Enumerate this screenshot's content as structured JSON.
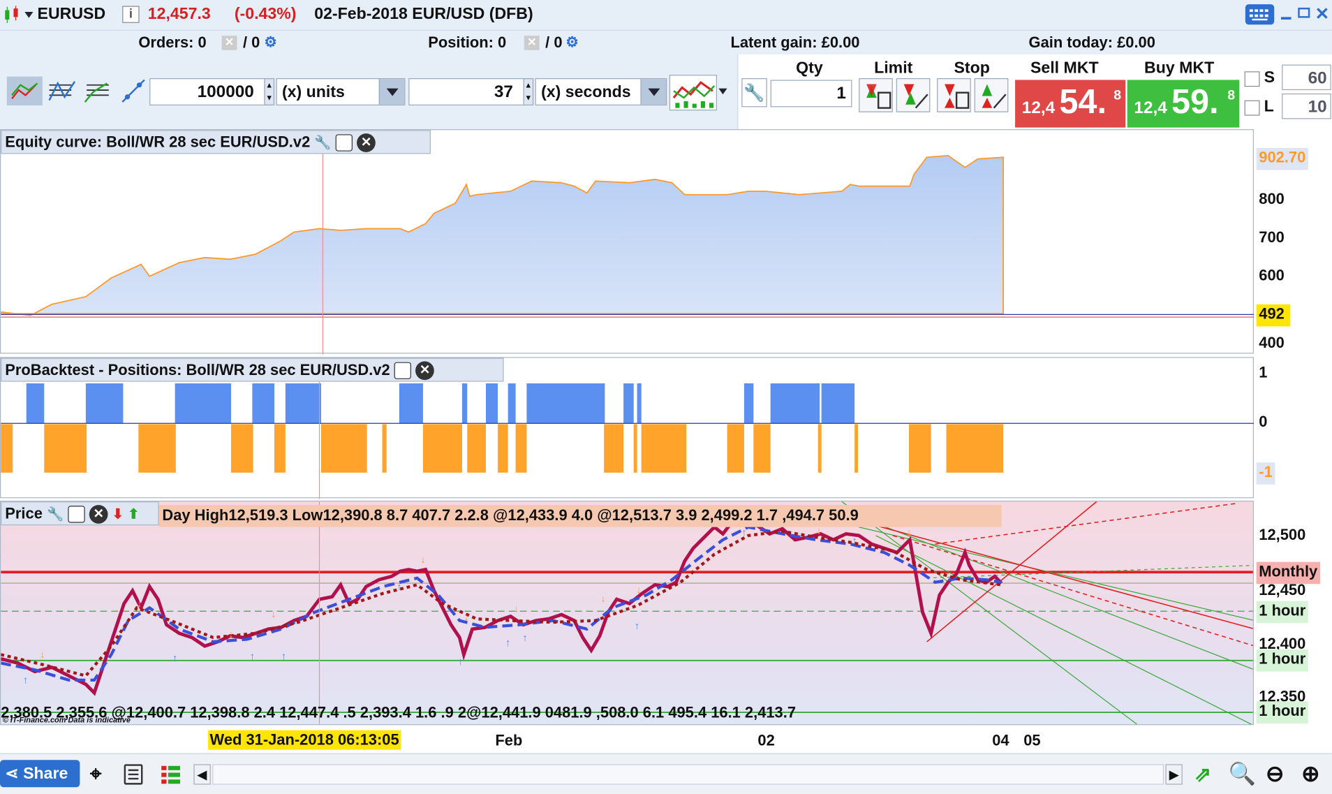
{
  "header": {
    "symbol": "EURUSD",
    "price": "12,457.3",
    "change": "(-0.43%)",
    "contract": "02-Feb-2018 EUR/USD (DFB)",
    "info_icon": "i"
  },
  "status": {
    "orders_label": "Orders: 0",
    "orders_sep": "/ 0",
    "position_label": "Position: 0",
    "position_sep": "/ 0",
    "latent_gain": "Latent gain: £0.00",
    "gain_today": "Gain today: £0.00"
  },
  "toolbar": {
    "units_value": "100000",
    "units_mode": "(x) units",
    "period_value": "37",
    "period_mode": "(x) seconds"
  },
  "order": {
    "qty_label": "Qty",
    "qty_value": "1",
    "limit_label": "Limit",
    "stop_label": "Stop",
    "sell_label": "Sell MKT",
    "buy_label": "Buy MKT",
    "sell_prefix": "12,4",
    "sell_big": "54.",
    "sell_sup": "8",
    "buy_prefix": "12,4",
    "buy_big": "59.",
    "buy_sup": "8",
    "s_label": "S",
    "s_value": "60",
    "l_label": "L",
    "l_value": "10"
  },
  "equity": {
    "title": "Equity curve: Boll/WR 28 sec EUR/USD.v2",
    "axis": [
      "800",
      "700",
      "600",
      "400"
    ],
    "last_value": "902.70",
    "start_value": "492"
  },
  "positions": {
    "title": "ProBacktest - Positions: Boll/WR 28 sec EUR/USD.v2",
    "axis": [
      "1",
      "0",
      "-1"
    ]
  },
  "price": {
    "title": "Price",
    "overlay_text": "Day High12,519.3 Low12,390.8 8.7 407.7 2.2.8 @12,433.9 4.0 @12,513.7 3.9 2,499.2 1.7 ,494.7 50.9",
    "axis": [
      "12,500",
      "12,450",
      "12,400",
      "12,350"
    ],
    "tags": [
      "Monthly",
      "1 hour",
      "1 hour",
      "1 hour"
    ],
    "bottom_labels": "2,380.5 2,355.6 @12,400.7 12,398.8 2.4 12,447.4 .5 2,393.4 1.6 .9 2@12,441.9 0481.9 ,508.0 6.1 495.4 16.1 2,413.7",
    "credit": "© IT-Finance.com  Data is indicative"
  },
  "time_axis": {
    "cursor": "Wed 31-Jan-2018 06:13:05",
    "labels": [
      "Feb",
      "02",
      "04",
      "05"
    ]
  },
  "bottom": {
    "share_label": "Share"
  },
  "colors": {
    "long": "#5b8ff0",
    "short": "#ffa32a",
    "price_line": "#b0104c",
    "ma_blue": "#3a50d8",
    "ma_red": "#a01818",
    "monthly": "#e02020"
  }
}
